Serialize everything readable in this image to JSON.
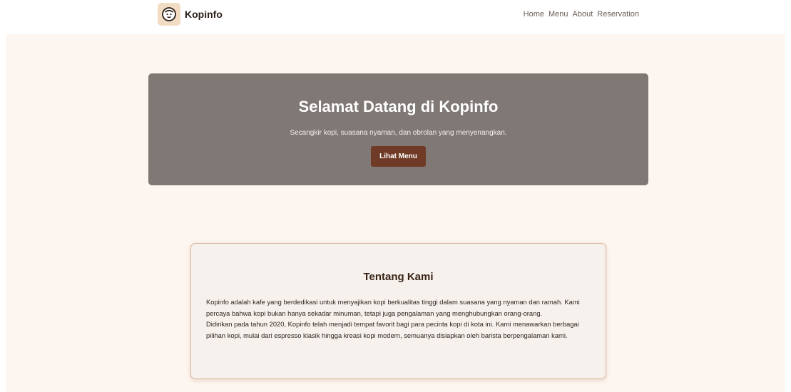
{
  "navbar": {
    "brand": "Kopinfo",
    "links": [
      "Home",
      "Menu",
      "About",
      "Reservation"
    ]
  },
  "hero": {
    "title": "Selamat Datang di Kopinfo",
    "subtitle": "Secangkir kopi, suasana nyaman, dan obrolan yang menyenangkan.",
    "button_label": "Lihat Menu"
  },
  "about": {
    "title": "Tentang Kami",
    "paragraph_1": "Kopinfo adalah kafe yang berdedikasi untuk menyajikan kopi berkualitas tinggi dalam suasana yang nyaman dan ramah. Kami percaya bahwa kopi bukan hanya sekadar minuman, tetapi juga pengalaman yang menghubungkan orang-orang.",
    "paragraph_2": "Didirikan pada tahun 2020, Kopinfo telah menjadi tempat favorit bagi para pecinta kopi di kota ini. Kami menawarkan berbagai pilihan kopi, mulai dari espresso klasik hingga kreasi kopi modern, semuanya disiapkan oleh barista berpengalaman kami."
  },
  "colors": {
    "page_background": "#fdf5ef",
    "hero_background": "#807874",
    "accent_button": "#6f3b26",
    "card_border": "#dcb79c"
  },
  "icons": {
    "logo": "coffee-cup-face-icon"
  }
}
